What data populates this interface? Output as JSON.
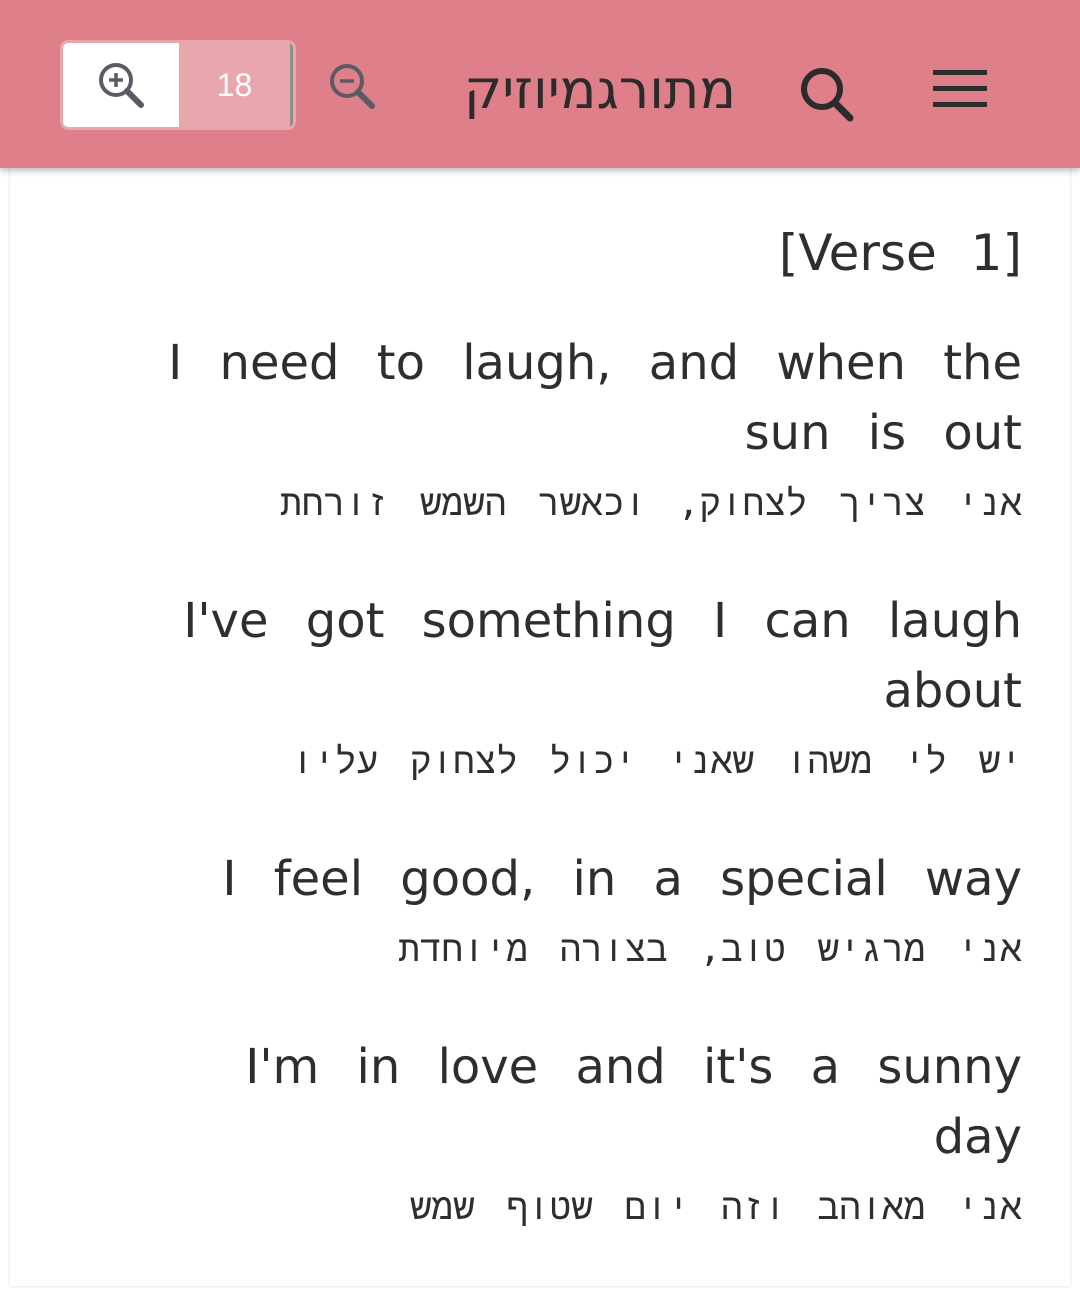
{
  "header": {
    "title": "מתורגמיוזיק",
    "zoom_level": "18",
    "menu_icon": "hamburger-menu-icon",
    "search_icon": "search-icon",
    "zoom_in_icon": "zoom-in-icon",
    "zoom_out_icon": "zoom-out-icon",
    "background_color": "#de7f8a",
    "zoom_level_bg": "#e9a6ad"
  },
  "lyrics": {
    "section": "[Verse 1]",
    "lines": [
      {
        "en": "I need to laugh, and when the sun is out",
        "he": "אני צריך לצחוק, וכאשר השמש זורחת"
      },
      {
        "en": "I've got something I can laugh about",
        "he": "יש לי משהו שאני יכול לצחוק עליו"
      },
      {
        "en": "I feel good, in a special way",
        "he": "אני מרגיש טוב, בצורה מיוחדת"
      },
      {
        "en": "I'm in love and it's a sunny day",
        "he": "אני מאוהב וזה יום שטוף שמש"
      }
    ]
  }
}
